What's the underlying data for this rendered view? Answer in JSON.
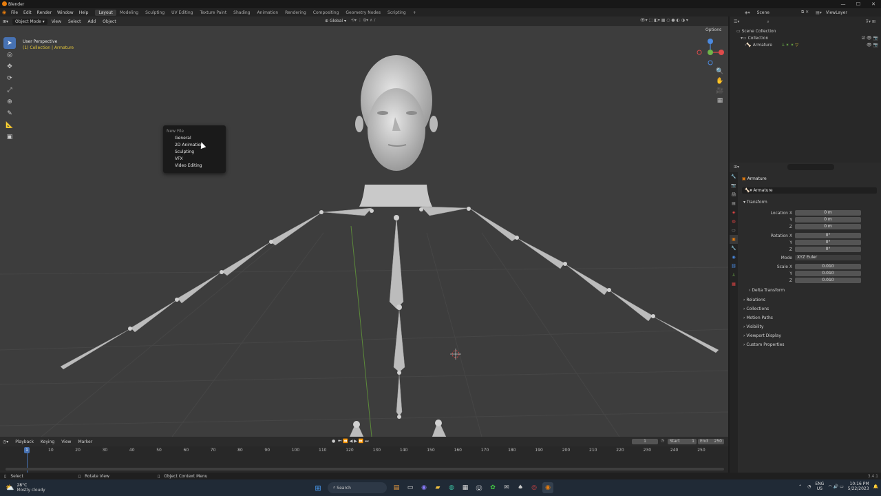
{
  "window": {
    "title": "Blender",
    "min": "—",
    "max": "☐",
    "close": "✕"
  },
  "menu": [
    "File",
    "Edit",
    "Render",
    "Window",
    "Help"
  ],
  "workspaces": [
    "Layout",
    "Modeling",
    "Sculpting",
    "UV Editing",
    "Texture Paint",
    "Shading",
    "Animation",
    "Rendering",
    "Compositing",
    "Geometry Nodes",
    "Scripting",
    "+"
  ],
  "scene": {
    "label": "Scene",
    "view_layer": "ViewLayer"
  },
  "viewport_header": {
    "mode": "Object Mode",
    "items": [
      "View",
      "Select",
      "Add",
      "Object"
    ],
    "orientation": "Global",
    "options": "Options"
  },
  "viewport": {
    "perspective": "User Perspective",
    "collection": "(1) Collection | Armature"
  },
  "new_file_menu": {
    "title": "New File",
    "items": [
      "General",
      "2D Animation",
      "Sculpting",
      "VFX",
      "Video Editing"
    ]
  },
  "outliner": {
    "scene_collection": "Scene Collection",
    "collection": "Collection",
    "armature": "Armature"
  },
  "properties": {
    "object_name": "Armature",
    "data_name": "Armature",
    "transform": "Transform",
    "location": [
      {
        "label": "Location X",
        "value": "0 m"
      },
      {
        "label": "Y",
        "value": "0 m"
      },
      {
        "label": "Z",
        "value": "0 m"
      }
    ],
    "rotation": [
      {
        "label": "Rotation X",
        "value": "0°"
      },
      {
        "label": "Y",
        "value": "0°"
      },
      {
        "label": "Z",
        "value": "0°"
      }
    ],
    "mode_label": "Mode",
    "mode_value": "XYZ Euler",
    "scale": [
      {
        "label": "Scale X",
        "value": "0.010"
      },
      {
        "label": "Y",
        "value": "0.010"
      },
      {
        "label": "Z",
        "value": "0.010"
      }
    ],
    "delta": "Delta Transform",
    "panels": [
      "Relations",
      "Collections",
      "Motion Paths",
      "Visibility",
      "Viewport Display",
      "Custom Properties"
    ]
  },
  "timeline": {
    "items": [
      "Playback",
      "Keying",
      "View",
      "Marker"
    ],
    "current_frame": "1",
    "start_label": "Start",
    "start": "1",
    "end_label": "End",
    "end": "250",
    "ruler": [
      "1",
      "10",
      "20",
      "30",
      "40",
      "50",
      "60",
      "70",
      "80",
      "90",
      "100",
      "110",
      "120",
      "130",
      "140",
      "150",
      "160",
      "170",
      "180",
      "190",
      "200",
      "210",
      "220",
      "230",
      "240",
      "250"
    ]
  },
  "statusbar": {
    "select": "Select",
    "rotate": "Rotate View",
    "context": "Object Context Menu",
    "version": "3.4.1"
  },
  "taskbar": {
    "temp": "28°C",
    "weather": "Mostly cloudy",
    "search": "Search",
    "lang1": "ENG",
    "lang2": "US",
    "time": "10:16 PM",
    "date": "5/22/2023"
  },
  "colors": {
    "accent": "#4772b3",
    "collection_text": "#e2c53a",
    "viewport_bg": "#3d3d3d"
  }
}
